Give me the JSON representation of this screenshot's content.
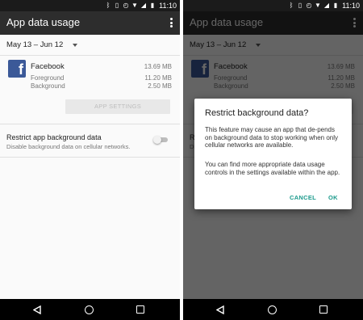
{
  "status_bar": {
    "time": "11:10",
    "icons": [
      "bluetooth-icon",
      "vibrate-icon",
      "alarm-icon",
      "wifi-icon",
      "signal-icon",
      "battery-icon"
    ]
  },
  "app_bar": {
    "title": "App data usage"
  },
  "date_range": "May 13 – Jun 12",
  "app": {
    "name": "Facebook",
    "total": "13.69 MB",
    "foreground_label": "Foreground",
    "foreground_value": "11.20 MB",
    "background_label": "Background",
    "background_value": "2.50 MB",
    "icon_letter": "f"
  },
  "app_settings_button": "APP SETTINGS",
  "restrict": {
    "title": "Restrict app background data",
    "subtitle": "Disable background data on cellular networks.",
    "enabled": false
  },
  "dialog": {
    "title": "Restrict background data?",
    "body1": "This feature may cause an app that de-pends on background data to stop working when only cellular networks are available.",
    "body2": "You can find more appropriate data usage controls in the settings available within the app.",
    "cancel": "CANCEL",
    "ok": "OK"
  },
  "colors": {
    "app_bar": "#2d2d2d",
    "facebook": "#3b5998",
    "accent": "#1b9a8c"
  }
}
